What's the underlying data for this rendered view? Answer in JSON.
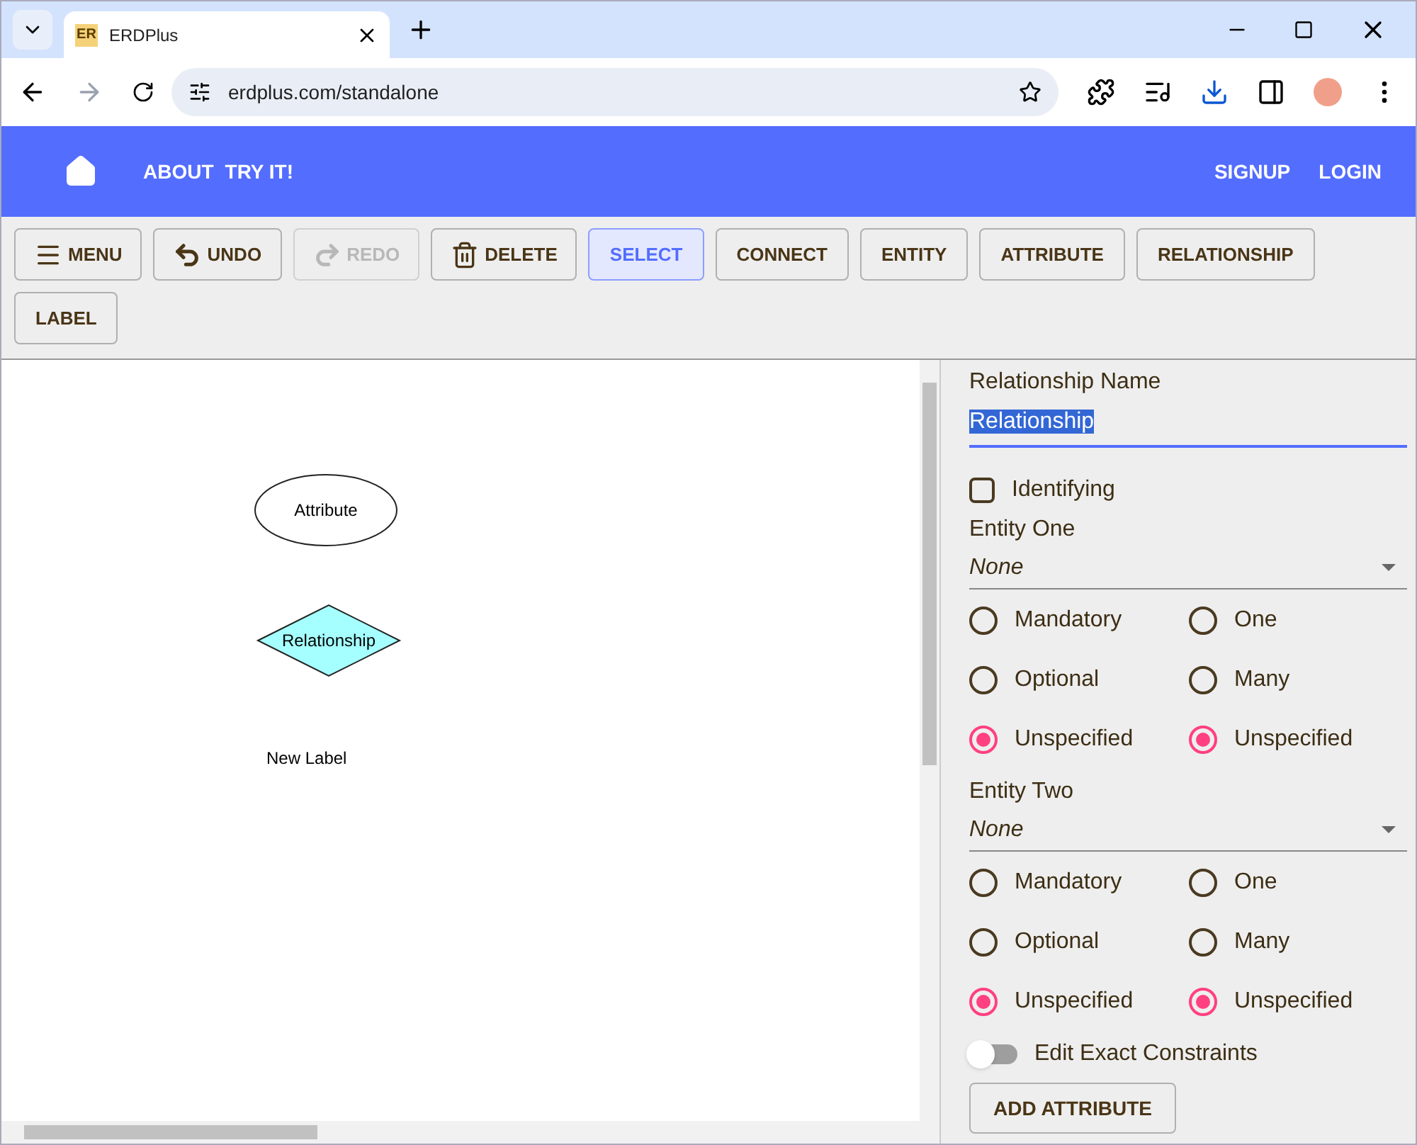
{
  "browser": {
    "tab_title": "ERDPlus",
    "tab_logo": "ER",
    "url": "erdplus.com/standalone"
  },
  "nav": {
    "left": [
      "ABOUT",
      "TRY IT!"
    ],
    "right": [
      "SIGNUP",
      "LOGIN"
    ]
  },
  "toolbar": [
    {
      "label": "MENU",
      "kind": "menu",
      "disabled": false,
      "selected": false
    },
    {
      "label": "UNDO",
      "kind": "undo",
      "disabled": false,
      "selected": false
    },
    {
      "label": "REDO",
      "kind": "redo",
      "disabled": true,
      "selected": false
    },
    {
      "label": "DELETE",
      "kind": "delete",
      "disabled": false,
      "selected": false
    },
    {
      "label": "SELECT",
      "kind": "text",
      "disabled": false,
      "selected": true
    },
    {
      "label": "CONNECT",
      "kind": "text",
      "disabled": false,
      "selected": false
    },
    {
      "label": "ENTITY",
      "kind": "text",
      "disabled": false,
      "selected": false
    },
    {
      "label": "ATTRIBUTE",
      "kind": "text",
      "disabled": false,
      "selected": false
    },
    {
      "label": "RELATIONSHIP",
      "kind": "text",
      "disabled": false,
      "selected": false
    },
    {
      "label": "LABEL",
      "kind": "text",
      "disabled": false,
      "selected": false
    }
  ],
  "canvas": {
    "shapes": [
      {
        "kind": "attribute",
        "label": "Attribute"
      },
      {
        "kind": "relationship",
        "label": "Relationship"
      },
      {
        "kind": "label",
        "label": "New Label"
      }
    ]
  },
  "panel": {
    "name_label": "Relationship Name",
    "name_value": "Relationship",
    "identifying": {
      "label": "Identifying",
      "checked": false
    },
    "entities": [
      {
        "label": "Entity One",
        "value": "None",
        "participation": [
          {
            "label": "Mandatory",
            "selected": false
          },
          {
            "label": "Optional",
            "selected": false
          },
          {
            "label": "Unspecified",
            "selected": true
          }
        ],
        "cardinality": [
          {
            "label": "One",
            "selected": false
          },
          {
            "label": "Many",
            "selected": false
          },
          {
            "label": "Unspecified",
            "selected": true
          }
        ]
      },
      {
        "label": "Entity Two",
        "value": "None",
        "participation": [
          {
            "label": "Mandatory",
            "selected": false
          },
          {
            "label": "Optional",
            "selected": false
          },
          {
            "label": "Unspecified",
            "selected": true
          }
        ],
        "cardinality": [
          {
            "label": "One",
            "selected": false
          },
          {
            "label": "Many",
            "selected": false
          },
          {
            "label": "Unspecified",
            "selected": true
          }
        ]
      }
    ],
    "exact_constraints": {
      "label": "Edit Exact Constraints",
      "on": false
    },
    "add_button": "ADD ATTRIBUTE"
  }
}
